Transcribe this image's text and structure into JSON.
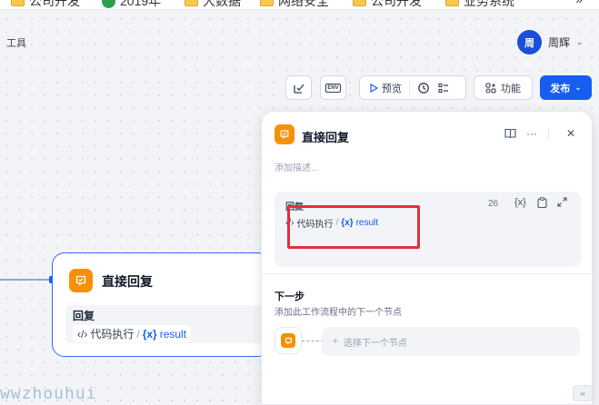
{
  "bookmarks": [
    {
      "label": "公司开发",
      "icon": "folder-icon"
    },
    {
      "label": "2019年",
      "icon": "chrome-c-icon"
    },
    {
      "label": "大数据",
      "icon": "folder-icon"
    },
    {
      "label": "网络安全",
      "icon": "folder-icon"
    },
    {
      "label": "公司开发",
      "icon": "folder-icon"
    },
    {
      "label": "业务系统",
      "icon": "folder-icon"
    }
  ],
  "bookmarks_more": "»",
  "header": {
    "tools_label": "工具",
    "user": {
      "avatar_text": "周",
      "name": "周辉"
    }
  },
  "toolbar": {
    "env_label": "ENV",
    "preview_label": "预览",
    "features_label": "功能",
    "publish_label": "发布"
  },
  "canvas_node": {
    "title": "直接回复",
    "body_label": "回复",
    "ref_source": "代码执行",
    "ref_separator": "/",
    "ref_var_icon": "{x}",
    "ref_var": "result"
  },
  "panel": {
    "title": "直接回复",
    "description_placeholder": "添加描述...",
    "reply": {
      "label": "回复",
      "char_count": "26",
      "var_button": "{x}",
      "ref_source": "代码执行",
      "ref_separator": "/",
      "ref_var_icon": "{x}",
      "ref_var": "result"
    },
    "next_step": {
      "title": "下一步",
      "description": "添加此工作流程中的下一个节点",
      "select_label": "选择下一个节点",
      "plus": "+"
    }
  },
  "watermark": "wwzhouhui",
  "colors": {
    "accent": "#155eef",
    "node_icon": "#f79009",
    "highlight": "#e0303b"
  }
}
